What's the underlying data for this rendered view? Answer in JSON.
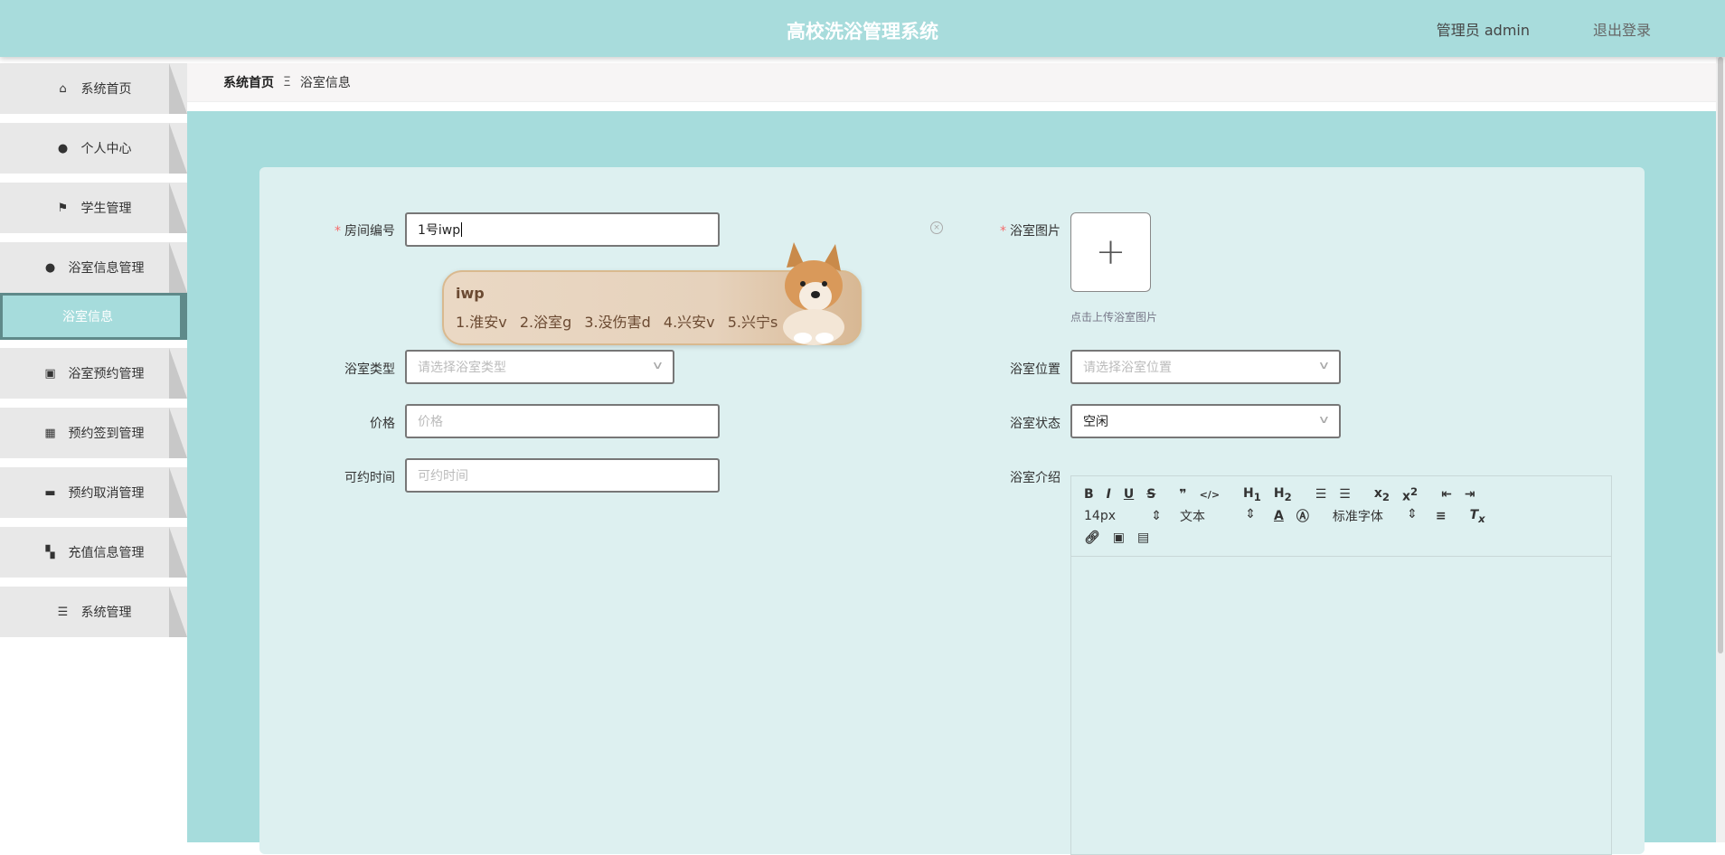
{
  "header": {
    "title": "高校洗浴管理系统",
    "user": "管理员 admin",
    "logout": "退出登录"
  },
  "sidebar": {
    "items": [
      {
        "label": "系统首页",
        "icon": "home-icon",
        "glyph": "⌂"
      },
      {
        "label": "个人中心",
        "icon": "user-icon",
        "glyph": "●"
      },
      {
        "label": "学生管理",
        "icon": "flag-icon",
        "glyph": "⚑"
      },
      {
        "label": "浴室信息管理",
        "icon": "bulb-icon",
        "glyph": "●"
      },
      {
        "label": "浴室预约管理",
        "icon": "chart-icon",
        "glyph": "▣"
      },
      {
        "label": "预约签到管理",
        "icon": "grid-icon",
        "glyph": "▦"
      },
      {
        "label": "预约取消管理",
        "icon": "comment-icon",
        "glyph": "▬"
      },
      {
        "label": "充值信息管理",
        "icon": "apps-icon",
        "glyph": "▚"
      },
      {
        "label": "系统管理",
        "icon": "list-icon",
        "glyph": "☰"
      }
    ],
    "active_sub": "浴室信息"
  },
  "breadcrumb": {
    "home": "系统首页",
    "sep": "Ξ",
    "current": "浴室信息"
  },
  "form": {
    "room_no": {
      "label": "房间编号",
      "value": "1号iwp"
    },
    "type": {
      "label": "浴室类型",
      "placeholder": "请选择浴室类型"
    },
    "price": {
      "label": "价格",
      "placeholder": "价格"
    },
    "time": {
      "label": "可约时间",
      "placeholder": "可约时间"
    },
    "image": {
      "label": "浴室图片",
      "hint": "点击上传浴室图片"
    },
    "location": {
      "label": "浴室位置",
      "placeholder": "请选择浴室位置"
    },
    "status": {
      "label": "浴室状态",
      "value": "空闲"
    },
    "intro": {
      "label": "浴室介绍"
    }
  },
  "editor": {
    "size": "14px",
    "format": "文本",
    "font": "标准字体"
  },
  "ime": {
    "composition": "iwp",
    "candidates": [
      "1.淮安v",
      "2.浴室g",
      "3.没伤害d",
      "4.兴安v",
      "5.兴宁s"
    ]
  }
}
